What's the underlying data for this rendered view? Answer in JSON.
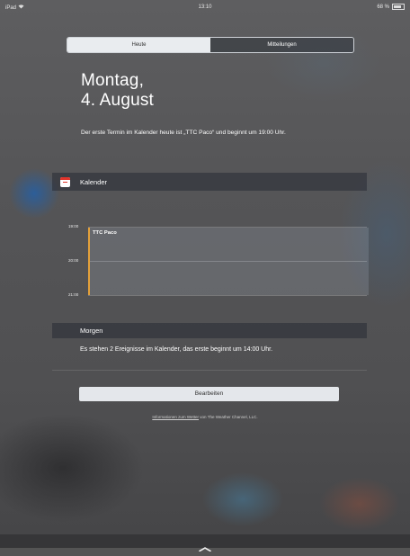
{
  "status_bar": {
    "device": "iPad",
    "wifi_icon": "wifi-icon",
    "time": "13:10",
    "battery_percent": "68 %",
    "battery_icon": "battery-icon"
  },
  "segmented_control": {
    "tabs": [
      {
        "label": "Heute",
        "selected": true
      },
      {
        "label": "Mitteilungen",
        "selected": false
      }
    ]
  },
  "today": {
    "weekday": "Montag,",
    "date": "4. August",
    "summary": "Der erste Termin im Kalender heute ist „TTC Paco“ und beginnt um 19:00 Uhr."
  },
  "calendar": {
    "section_title": "Kalender",
    "icon": "calendar-icon",
    "time_labels": [
      "19:00",
      "20:00",
      "21:00"
    ],
    "event": {
      "title": "TTC Paco",
      "color": "#e3a03a"
    }
  },
  "tomorrow": {
    "section_title": "Morgen",
    "text": "Es stehen 2 Ereignisse im Kalender, das erste beginnt um 14:00 Uhr."
  },
  "edit_button": {
    "label": "Bearbeiten"
  },
  "footer": {
    "link_text": "Informationen zum Wetter",
    "suffix": " von The Weather Channel, LLC."
  },
  "bottom": {
    "handle_icon": "chevron-up-icon"
  }
}
